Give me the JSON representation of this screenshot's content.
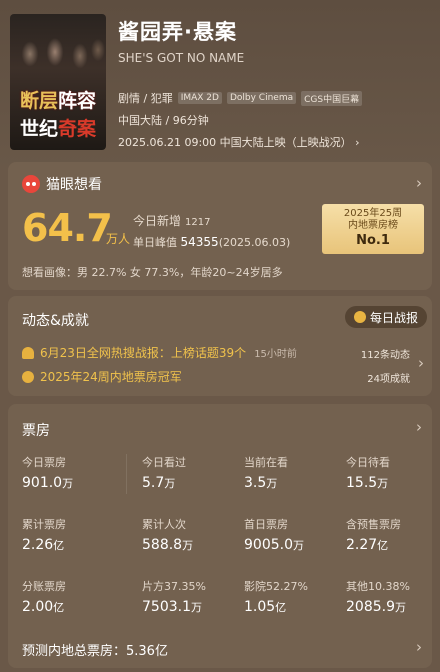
{
  "movie": {
    "poster_line1_a": "断层",
    "poster_line1_b": "阵容",
    "poster_line2_a": "世纪",
    "poster_line2_b": "奇案",
    "title": "酱园弄·悬案",
    "subtitle": "SHE'S GOT NO NAME",
    "genre": "剧情 / 犯罪",
    "tags": [
      "IMAX 2D",
      "Dolby Cinema",
      "CGS中国巨幕"
    ],
    "origin": "中国大陆 / 96分钟",
    "release": "2025.06.21 09:00 中国大陆上映（上映战况）"
  },
  "want": {
    "title": "猫眼想看",
    "number": "64.7",
    "unit": "万人",
    "today_label": "今日新增",
    "today_value": "1217",
    "peak_label": "单日峰值",
    "peak_value": "54355",
    "peak_date": "(2025.06.03)",
    "rank_line1": "2025年25周",
    "rank_line2": "内地票房榜",
    "rank_no": "No.1",
    "demographics": "想看画像：男 22.7%  女 77.3%，年龄20~24岁居多"
  },
  "dynamics": {
    "title": "动态&成就",
    "report_label": "每日战报",
    "item1": "6月23日全网热搜战报：上榜话题39个",
    "item1_time": "15小时前",
    "item1_count": "112条动态",
    "item2": "2025年24周内地票房冠军",
    "item2_count": "24项成就"
  },
  "boxoffice": {
    "title": "票房",
    "cells": [
      {
        "label": "今日票房",
        "value": "901.0",
        "unit": "万"
      },
      {
        "label": "今日看过",
        "value": "5.7",
        "unit": "万"
      },
      {
        "label": "当前在看",
        "value": "3.5",
        "unit": "万"
      },
      {
        "label": "今日待看",
        "value": "15.5",
        "unit": "万"
      },
      {
        "label": "累计票房",
        "value": "2.26",
        "unit": "亿"
      },
      {
        "label": "累计人次",
        "value": "588.8",
        "unit": "万"
      },
      {
        "label": "首日票房",
        "value": "9005.0",
        "unit": "万"
      },
      {
        "label": "含预售票房",
        "value": "2.27",
        "unit": "亿"
      },
      {
        "label": "分账票房",
        "value": "2.00",
        "unit": "亿"
      },
      {
        "label": "片方37.35%",
        "value": "7503.1",
        "unit": "万"
      },
      {
        "label": "影院52.27%",
        "value": "1.05",
        "unit": "亿"
      },
      {
        "label": "其他10.38%",
        "value": "2085.9",
        "unit": "万"
      }
    ],
    "forecast": "预测内地总票房：5.36亿"
  },
  "colors": {
    "accent_gold": "#f3c04a",
    "brand_red": "#e9463b",
    "background": "#6a5848"
  }
}
